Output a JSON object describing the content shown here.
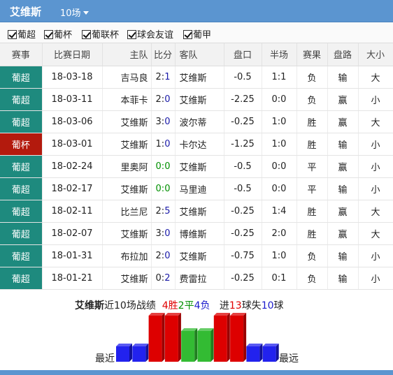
{
  "header": {
    "team": "艾维斯",
    "count_label": "10场"
  },
  "filters": [
    {
      "label": "葡超",
      "checked": true
    },
    {
      "label": "葡杯",
      "checked": true
    },
    {
      "label": "葡联杯",
      "checked": true
    },
    {
      "label": "球会友谊",
      "checked": true
    },
    {
      "label": "葡甲",
      "checked": true
    }
  ],
  "table": {
    "headers": [
      "赛事",
      "比赛日期",
      "主队",
      "比分",
      "客队",
      "盘口",
      "半场",
      "赛果",
      "盘路",
      "大小"
    ],
    "rows": [
      {
        "league": "葡超",
        "date": "18-03-18",
        "home": "吉马良",
        "score_home": "2",
        "score_sep": ":",
        "score_away": "1",
        "away": "艾维斯",
        "handicap": "-0.5",
        "half": "1:1",
        "result": "负",
        "pan": "输",
        "ou": "大"
      },
      {
        "league": "葡超",
        "date": "18-03-11",
        "home": "本菲卡",
        "score_home": "2",
        "score_sep": ":",
        "score_away": "0",
        "away": "艾维斯",
        "handicap": "-2.25",
        "half": "0:0",
        "result": "负",
        "pan": "赢",
        "ou": "小"
      },
      {
        "league": "葡超",
        "date": "18-03-06",
        "home": "艾维斯",
        "score_home": "3",
        "score_sep": ":",
        "score_away": "0",
        "away": "波尔蒂",
        "handicap": "-0.25",
        "half": "1:0",
        "result": "胜",
        "pan": "赢",
        "ou": "大"
      },
      {
        "league": "葡杯",
        "date": "18-03-01",
        "home": "艾维斯",
        "score_home": "1",
        "score_sep": ":",
        "score_away": "0",
        "away": "卡尔达",
        "handicap": "-1.25",
        "half": "1:0",
        "result": "胜",
        "pan": "输",
        "ou": "小"
      },
      {
        "league": "葡超",
        "date": "18-02-24",
        "home": "里奥阿",
        "score_home": "0",
        "score_sep": ":",
        "score_away": "0",
        "away": "艾维斯",
        "handicap": "-0.5",
        "half": "0:0",
        "result": "平",
        "pan": "赢",
        "ou": "小"
      },
      {
        "league": "葡超",
        "date": "18-02-17",
        "home": "艾维斯",
        "score_home": "0",
        "score_sep": ":",
        "score_away": "0",
        "away": "马里迪",
        "handicap": "-0.5",
        "half": "0:0",
        "result": "平",
        "pan": "输",
        "ou": "小"
      },
      {
        "league": "葡超",
        "date": "18-02-11",
        "home": "比兰尼",
        "score_home": "2",
        "score_sep": ":",
        "score_away": "5",
        "away": "艾维斯",
        "handicap": "-0.25",
        "half": "1:4",
        "result": "胜",
        "pan": "赢",
        "ou": "大"
      },
      {
        "league": "葡超",
        "date": "18-02-07",
        "home": "艾维斯",
        "score_home": "3",
        "score_sep": ":",
        "score_away": "0",
        "away": "博维斯",
        "handicap": "-0.25",
        "half": "2:0",
        "result": "胜",
        "pan": "赢",
        "ou": "大"
      },
      {
        "league": "葡超",
        "date": "18-01-31",
        "home": "布拉加",
        "score_home": "2",
        "score_sep": ":",
        "score_away": "0",
        "away": "艾维斯",
        "handicap": "-0.75",
        "half": "1:0",
        "result": "负",
        "pan": "输",
        "ou": "小"
      },
      {
        "league": "葡超",
        "date": "18-01-21",
        "home": "艾维斯",
        "score_home": "0",
        "score_sep": ":",
        "score_away": "2",
        "away": "费雷拉",
        "handicap": "-0.25",
        "half": "0:1",
        "result": "负",
        "pan": "输",
        "ou": "小"
      }
    ]
  },
  "summary": {
    "team": "艾维斯",
    "recent_text": "近10场战绩",
    "wins": "4胜",
    "draws": "2平",
    "losses": "4负",
    "goals_prefix": "进",
    "goals_for": "13",
    "goals_mid": "球失",
    "goals_against": "10",
    "goals_suffix": "球",
    "near_label": "最近",
    "far_label": "最远"
  },
  "colors": {
    "header_blue": "#5b95d0",
    "league_teal": "#1e8a7e",
    "cup_red": "#b31a0d",
    "win_red": "#d40000",
    "loss_blue": "#1a1aa8",
    "draw_green": "#009000"
  },
  "chart_data": {
    "type": "bar",
    "categories": [
      "1",
      "2",
      "3",
      "4",
      "5",
      "6",
      "7",
      "8",
      "9",
      "10"
    ],
    "values": [
      1,
      1,
      3,
      3,
      2,
      2,
      3,
      3,
      1,
      1
    ],
    "results": [
      "负",
      "负",
      "胜",
      "胜",
      "平",
      "平",
      "胜",
      "胜",
      "负",
      "负"
    ],
    "colors": {
      "win": "#dd0000",
      "draw": "#33bb33",
      "loss": "#2222ee"
    }
  }
}
